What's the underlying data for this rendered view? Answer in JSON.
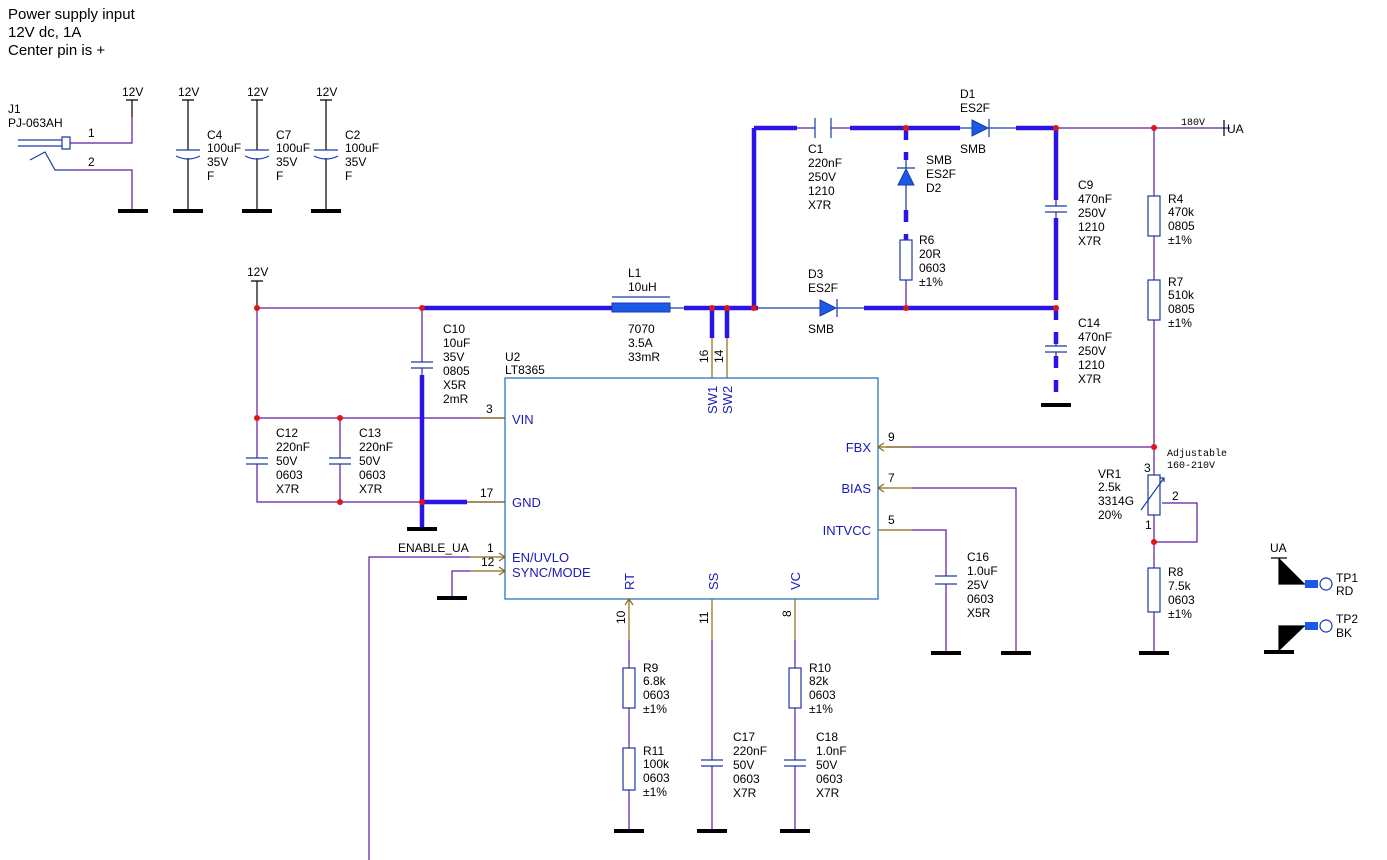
{
  "title_lines": [
    "Power supply input",
    "12V dc, 1A",
    "Center pin is +"
  ],
  "nets": {
    "v12": "12V",
    "v180": "180V",
    "ua": "UA",
    "enable": "ENABLE_UA"
  },
  "j1": {
    "ref": "J1",
    "value": "PJ-063AH",
    "pin1": "1",
    "pin2": "2"
  },
  "c4": [
    "C4",
    "100uF",
    "35V",
    "F"
  ],
  "c7": [
    "C7",
    "100uF",
    "35V",
    "F"
  ],
  "c2": [
    "C2",
    "100uF",
    "35V",
    "F"
  ],
  "l1": {
    "ref": "L1",
    "value": "10uH",
    "package": "7070",
    "current": "3.5A",
    "dcr": "33mR"
  },
  "c10": [
    "C10",
    "10uF",
    "35V",
    "0805",
    "X5R",
    "2mR"
  ],
  "c12": [
    "C12",
    "220nF",
    "50V",
    "0603",
    "X7R"
  ],
  "c13": [
    "C13",
    "220nF",
    "50V",
    "0603",
    "X7R"
  ],
  "c1": [
    "C1",
    "220nF",
    "250V",
    "1210",
    "X7R"
  ],
  "d1": {
    "ref": "D1",
    "value": "ES2F",
    "package": "SMB"
  },
  "d2": {
    "package": "SMB",
    "value": "ES2F",
    "ref": "D2"
  },
  "d3": {
    "ref": "D3",
    "value": "ES2F",
    "package": "SMB"
  },
  "r6": [
    "R6",
    "20R",
    "0603",
    "±1%"
  ],
  "c9": [
    "C9",
    "470nF",
    "250V",
    "1210",
    "X7R"
  ],
  "c14": [
    "C14",
    "470nF",
    "250V",
    "1210",
    "X7R"
  ],
  "r4": [
    "R4",
    "470k",
    "0805",
    "±1%"
  ],
  "r7": [
    "R7",
    "510k",
    "0805",
    "±1%"
  ],
  "vr1": {
    "ref": "VR1",
    "value": "2.5k",
    "model": "3314G",
    "tol": "20%",
    "note1": "Adjustable",
    "note2": "160-210V",
    "p1": "1",
    "p2": "2",
    "p3": "3"
  },
  "r8": [
    "R8",
    "7.5k",
    "0603",
    "±1%"
  ],
  "c16": [
    "C16",
    "1.0uF",
    "25V",
    "0603",
    "X5R"
  ],
  "r9": [
    "R9",
    "6.8k",
    "0603",
    "±1%"
  ],
  "r11": [
    "R11",
    "100k",
    "0603",
    "±1%"
  ],
  "c17": [
    "C17",
    "220nF",
    "50V",
    "0603",
    "X7R"
  ],
  "r10": [
    "R10",
    "82k",
    "0603",
    "±1%"
  ],
  "c18": [
    "C18",
    "1.0nF",
    "50V",
    "0603",
    "X7R"
  ],
  "u2": {
    "ref": "U2",
    "value": "LT8365",
    "pins": {
      "vin": {
        "name": "VIN",
        "num": "3"
      },
      "gnd": {
        "name": "GND",
        "num": "17"
      },
      "en": {
        "name": "EN/UVLO",
        "num": "1"
      },
      "sync": {
        "name": "SYNC/MODE",
        "num": "12"
      },
      "sw1": {
        "name": "SW1",
        "num": "16"
      },
      "sw2": {
        "name": "SW2",
        "num": "14"
      },
      "fbx": {
        "name": "FBX",
        "num": "9"
      },
      "bias": {
        "name": "BIAS",
        "num": "7"
      },
      "intvcc": {
        "name": "INTVCC",
        "num": "5"
      },
      "rt": {
        "name": "RT",
        "num": "10"
      },
      "ss": {
        "name": "SS",
        "num": "11"
      },
      "vc": {
        "name": "VC",
        "num": "8"
      }
    }
  },
  "tp1": {
    "ref": "TP1",
    "label": "RD"
  },
  "tp2": {
    "ref": "TP2",
    "label": "BK"
  },
  "colors": {
    "wire": "#5a1aa0",
    "power_wire": "#2a14e6",
    "component": "#1a3aa8",
    "junction": "#e01515",
    "pin_label": "#1a1ab8"
  }
}
